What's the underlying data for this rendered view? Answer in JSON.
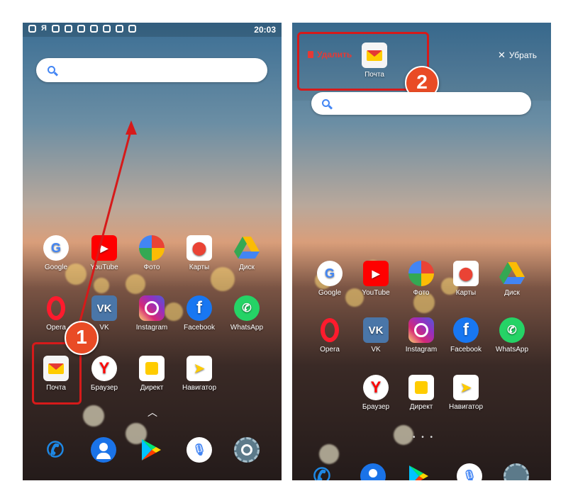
{
  "left": {
    "status_time": "20:03",
    "status_icon_y": "Я",
    "apps_row1": [
      {
        "label": "Google",
        "icon": "google-icon"
      },
      {
        "label": "YouTube",
        "icon": "youtube-icon"
      },
      {
        "label": "Фото",
        "icon": "photos-icon"
      },
      {
        "label": "Карты",
        "icon": "maps-icon"
      },
      {
        "label": "Диск",
        "icon": "drive-icon"
      }
    ],
    "apps_row2": [
      {
        "label": "Opera",
        "icon": "opera-icon"
      },
      {
        "label": "VK",
        "icon": "vk-icon"
      },
      {
        "label": "Instagram",
        "icon": "instagram-icon"
      },
      {
        "label": "Facebook",
        "icon": "facebook-icon"
      },
      {
        "label": "WhatsApp",
        "icon": "whatsapp-icon"
      }
    ],
    "apps_row3": [
      {
        "label": "Почта",
        "icon": "mail-icon"
      },
      {
        "label": "Браузер",
        "icon": "yandex-browser-icon"
      },
      {
        "label": "Директ",
        "icon": "direct-icon"
      },
      {
        "label": "Навигатор",
        "icon": "navigator-icon"
      }
    ],
    "dock": [
      "phone-icon",
      "contacts-icon",
      "play-store-icon",
      "microphone-icon",
      "settings-icon"
    ],
    "step_badge": "1"
  },
  "right": {
    "delete_label": "Удалить",
    "remove_label": "Убрать",
    "dragged_app_label": "Почта",
    "apps_row1": [
      "Google",
      "YouTube",
      "Фото",
      "Карты",
      "Диск"
    ],
    "apps_row2": [
      "Opera",
      "VK",
      "Instagram",
      "Facebook",
      "WhatsApp"
    ],
    "apps_row3": [
      "Браузер",
      "Директ",
      "Навигатор"
    ],
    "step_badge": "2"
  },
  "colors": {
    "annotation_red": "#d61a1a",
    "badge_orange": "#e94b25",
    "delete_red": "#e53935"
  }
}
